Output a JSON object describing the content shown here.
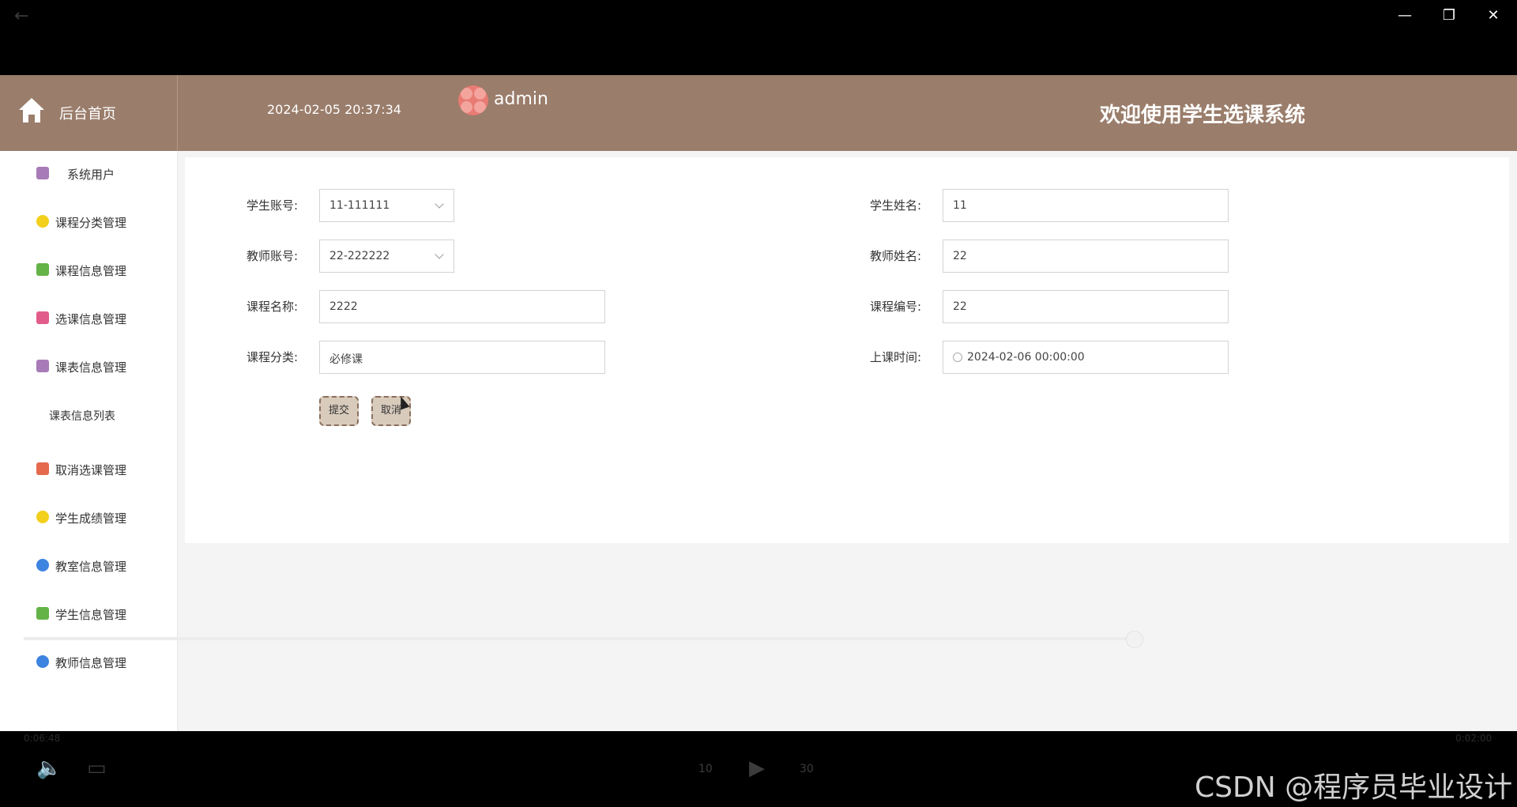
{
  "window": {
    "back_glyph": "←",
    "minimize_glyph": "—",
    "restore_glyph": "❐",
    "close_glyph": "✕"
  },
  "header": {
    "home_label": "后台首页",
    "datetime": "2024-02-05 20:37:34",
    "username": "admin",
    "welcome": "欢迎使用学生选课系统"
  },
  "sidebar": {
    "items": [
      {
        "label": "系统用户",
        "icon": "archive-icon",
        "color": "#a77bb8"
      },
      {
        "label": "课程分类管理",
        "icon": "hexagon-icon",
        "color": "#f2d01b"
      },
      {
        "label": "课程信息管理",
        "icon": "chat-icon",
        "color": "#64b347"
      },
      {
        "label": "选课信息管理",
        "icon": "badge-icon",
        "color": "#e25c8b"
      },
      {
        "label": "课表信息管理",
        "icon": "archive-icon",
        "color": "#a77bb8"
      },
      {
        "label": "取消选课管理",
        "icon": "grid-icon",
        "color": "#e4694d"
      },
      {
        "label": "学生成绩管理",
        "icon": "hexagon-icon",
        "color": "#f2d01b"
      },
      {
        "label": "教室信息管理",
        "icon": "star-icon",
        "color": "#3d83e0"
      },
      {
        "label": "学生信息管理",
        "icon": "chat-icon",
        "color": "#64b347"
      },
      {
        "label": "教师信息管理",
        "icon": "star-icon",
        "color": "#3d83e0"
      }
    ],
    "submenu_label": "课表信息列表"
  },
  "form": {
    "student_account": {
      "label": "学生账号:",
      "value": "11-111111"
    },
    "student_name": {
      "label": "学生姓名:",
      "value": "11"
    },
    "teacher_account": {
      "label": "教师账号:",
      "value": "22-222222"
    },
    "teacher_name": {
      "label": "教师姓名:",
      "value": "22"
    },
    "course_name": {
      "label": "课程名称:",
      "value": "2222"
    },
    "course_code": {
      "label": "课程编号:",
      "value": "22"
    },
    "course_category": {
      "label": "课程分类:",
      "value": "必修课"
    },
    "class_time": {
      "label": "上课时间:",
      "value": "2024-02-06 00:00:00"
    },
    "submit_label": "提交",
    "cancel_label": "取消"
  },
  "player": {
    "elapsed": "0:06:48",
    "duration": "0:02:00",
    "progress_fraction": 0.83,
    "rewind_label": "10",
    "forward_label": "30"
  },
  "watermark": "CSDN @程序员毕业设计"
}
